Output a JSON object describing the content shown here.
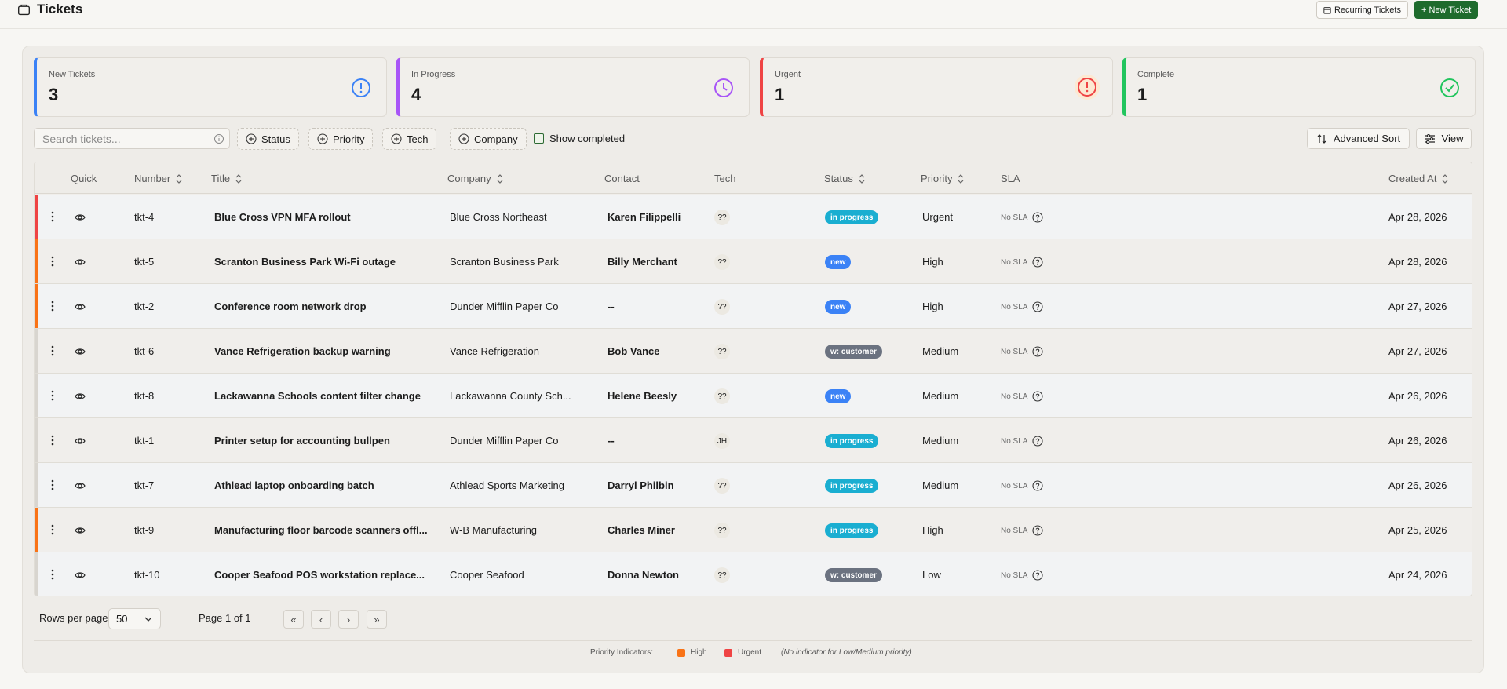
{
  "header": {
    "title": "Tickets",
    "recurring_label": "Recurring Tickets",
    "new_ticket_label": "+ New Ticket"
  },
  "cards": [
    {
      "label": "New Tickets",
      "value": "3",
      "color": "#3b82f6",
      "icon": "alert-circle-icon"
    },
    {
      "label": "In Progress",
      "value": "4",
      "color": "#a855f7",
      "icon": "clock-icon"
    },
    {
      "label": "Urgent",
      "value": "1",
      "color": "#ef4444",
      "icon": "alert-circle-icon"
    },
    {
      "label": "Complete",
      "value": "1",
      "color": "#22c55e",
      "icon": "check-circle-icon"
    }
  ],
  "filters": {
    "search_placeholder": "Search tickets...",
    "status": "Status",
    "priority": "Priority",
    "tech": "Tech",
    "company": "Company",
    "show_completed": "Show completed",
    "advanced_sort": "Advanced Sort",
    "view": "View"
  },
  "columns": {
    "quick": "Quick",
    "number": "Number",
    "title": "Title",
    "company": "Company",
    "contact": "Contact",
    "tech": "Tech",
    "status": "Status",
    "priority": "Priority",
    "sla": "SLA",
    "created": "Created At"
  },
  "rows": [
    {
      "number": "tkt-4",
      "title": "Blue Cross VPN MFA rollout",
      "company": "Blue Cross Northeast",
      "contact": "Karen Filippelli",
      "tech": "??",
      "status": "in progress",
      "status_color": "#1aaed1",
      "priority": "Urgent",
      "indicator": "#ef4444",
      "sla": "No SLA",
      "created": "Apr 28, 2026"
    },
    {
      "number": "tkt-5",
      "title": "Scranton Business Park Wi-Fi outage",
      "company": "Scranton Business Park",
      "contact": "Billy Merchant",
      "tech": "??",
      "status": "new",
      "status_color": "#3b82f6",
      "priority": "High",
      "indicator": "#f97316",
      "sla": "No SLA",
      "created": "Apr 28, 2026"
    },
    {
      "number": "tkt-2",
      "title": "Conference room network drop",
      "company": "Dunder Mifflin Paper Co",
      "contact": "--",
      "tech": "??",
      "status": "new",
      "status_color": "#3b82f6",
      "priority": "High",
      "indicator": "#f97316",
      "sla": "No SLA",
      "created": "Apr 27, 2026"
    },
    {
      "number": "tkt-6",
      "title": "Vance Refrigeration backup warning",
      "company": "Vance Refrigeration",
      "contact": "Bob Vance",
      "tech": "??",
      "status": "w: customer",
      "status_color": "#6b7280",
      "priority": "Medium",
      "indicator": "#d8d5cf",
      "sla": "No SLA",
      "created": "Apr 27, 2026"
    },
    {
      "number": "tkt-8",
      "title": "Lackawanna Schools content filter change",
      "company": "Lackawanna County Sch...",
      "contact": "Helene Beesly",
      "tech": "??",
      "status": "new",
      "status_color": "#3b82f6",
      "priority": "Medium",
      "indicator": "#d8d5cf",
      "sla": "No SLA",
      "created": "Apr 26, 2026"
    },
    {
      "number": "tkt-1",
      "title": "Printer setup for accounting bullpen",
      "company": "Dunder Mifflin Paper Co",
      "contact": "--",
      "tech": "JH",
      "status": "in progress",
      "status_color": "#1aaed1",
      "priority": "Medium",
      "indicator": "#d8d5cf",
      "sla": "No SLA",
      "created": "Apr 26, 2026"
    },
    {
      "number": "tkt-7",
      "title": "Athlead laptop onboarding batch",
      "company": "Athlead Sports Marketing",
      "contact": "Darryl Philbin",
      "tech": "??",
      "status": "in progress",
      "status_color": "#1aaed1",
      "priority": "Medium",
      "indicator": "#d8d5cf",
      "sla": "No SLA",
      "created": "Apr 26, 2026"
    },
    {
      "number": "tkt-9",
      "title": "Manufacturing floor barcode scanners offl...",
      "company": "W-B Manufacturing",
      "contact": "Charles Miner",
      "tech": "??",
      "status": "in progress",
      "status_color": "#1aaed1",
      "priority": "High",
      "indicator": "#f97316",
      "sla": "No SLA",
      "created": "Apr 25, 2026"
    },
    {
      "number": "tkt-10",
      "title": "Cooper Seafood POS workstation replace...",
      "company": "Cooper Seafood",
      "contact": "Donna Newton",
      "tech": "??",
      "status": "w: customer",
      "status_color": "#6b7280",
      "priority": "Low",
      "indicator": "#d8d5cf",
      "sla": "No SLA",
      "created": "Apr 24, 2026"
    }
  ],
  "pagination": {
    "rows_per_page_label": "Rows per page",
    "rows_per_page": "50",
    "page_label": "Page 1 of 1"
  },
  "legend": {
    "title": "Priority Indicators:",
    "high": "High",
    "urgent": "Urgent",
    "note": "(No indicator for Low/Medium priority)",
    "high_color": "#f97316",
    "urgent_color": "#ef4444"
  }
}
